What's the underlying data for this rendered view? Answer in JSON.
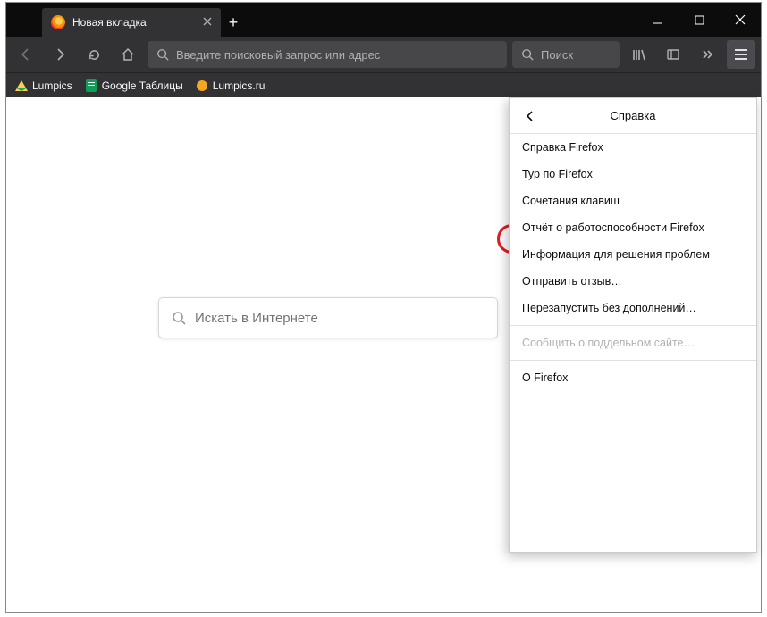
{
  "tab": {
    "title": "Новая вкладка"
  },
  "urlbar": {
    "placeholder": "Введите поисковый запрос или адрес"
  },
  "searchbox": {
    "placeholder": "Поиск"
  },
  "bookmarks": {
    "items": [
      {
        "label": "Lumpics"
      },
      {
        "label": "Google Таблицы"
      },
      {
        "label": "Lumpics.ru"
      }
    ]
  },
  "center_search": {
    "placeholder": "Искать в Интернете"
  },
  "help_panel": {
    "title": "Справка",
    "items": [
      {
        "label": "Справка Firefox"
      },
      {
        "label": "Тур по Firefox"
      },
      {
        "label": "Сочетания клавиш"
      },
      {
        "label": "Отчёт о работоспособности Firefox"
      },
      {
        "label": "Информация для решения проблем"
      },
      {
        "label": "Отправить отзыв…"
      },
      {
        "label": "Перезапустить без дополнений…"
      },
      {
        "label": "Сообщить о поддельном сайте…"
      },
      {
        "label": "О Firefox"
      }
    ]
  }
}
